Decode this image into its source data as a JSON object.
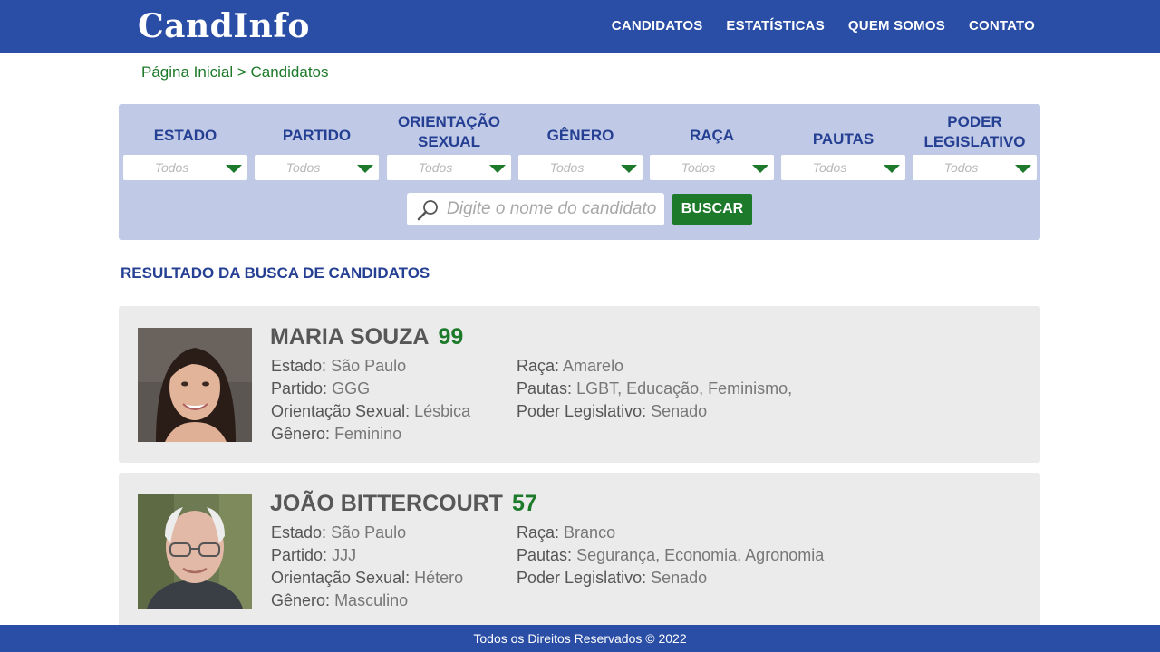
{
  "header": {
    "logo": "CandInfo",
    "nav": [
      "CANDIDATOS",
      "ESTATÍSTICAS",
      "QUEM SOMOS",
      "CONTATO"
    ]
  },
  "breadcrumb": "Página Inicial > Candidatos",
  "filters": [
    {
      "label": "ESTADO",
      "value": "Todos"
    },
    {
      "label": "PARTIDO",
      "value": "Todos"
    },
    {
      "label": "ORIENTAÇÃO SEXUAL",
      "value": "Todos"
    },
    {
      "label": "GÊNERO",
      "value": "Todos"
    },
    {
      "label": "RAÇA",
      "value": "Todos"
    },
    {
      "label": "PAUTAS",
      "value": "Todos"
    },
    {
      "label": "PODER LEGISLATIVO",
      "value": "Todos"
    }
  ],
  "search": {
    "placeholder": "Digite o nome do candidato",
    "button": "BUSCAR"
  },
  "results_title": "RESULTADO DA BUSCA DE CANDIDATOS",
  "candidates": [
    {
      "name": "MARIA SOUZA",
      "number": "99",
      "left": [
        {
          "key": "Estado",
          "value": "São Paulo"
        },
        {
          "key": "Partido",
          "value": "GGG"
        },
        {
          "key": "Orientação Sexual",
          "value": "Lésbica"
        },
        {
          "key": "Gênero",
          "value": "Feminino"
        }
      ],
      "right": [
        {
          "key": "Raça",
          "value": "Amarelo"
        },
        {
          "key": "Pautas",
          "value": "LGBT, Educação, Feminismo,"
        },
        {
          "key": "Poder Legislativo",
          "value": "Senado"
        }
      ]
    },
    {
      "name": "JOÃO BITTERCOURT",
      "number": "57",
      "left": [
        {
          "key": "Estado",
          "value": "São Paulo"
        },
        {
          "key": "Partido",
          "value": "JJJ"
        },
        {
          "key": "Orientação Sexual",
          "value": "Hétero"
        },
        {
          "key": "Gênero",
          "value": "Masculino"
        }
      ],
      "right": [
        {
          "key": "Raça",
          "value": "Branco"
        },
        {
          "key": "Pautas",
          "value": "Segurança, Economia, Agronomia"
        },
        {
          "key": "Poder Legislativo",
          "value": "Senado"
        }
      ]
    }
  ],
  "footer": "Todos os Direitos Reservados © 2022",
  "colors": {
    "brand_blue": "#2a4ea6",
    "accent_green": "#1c7a2a",
    "filter_panel": "#c0cae6",
    "card_bg": "#ebebeb"
  }
}
